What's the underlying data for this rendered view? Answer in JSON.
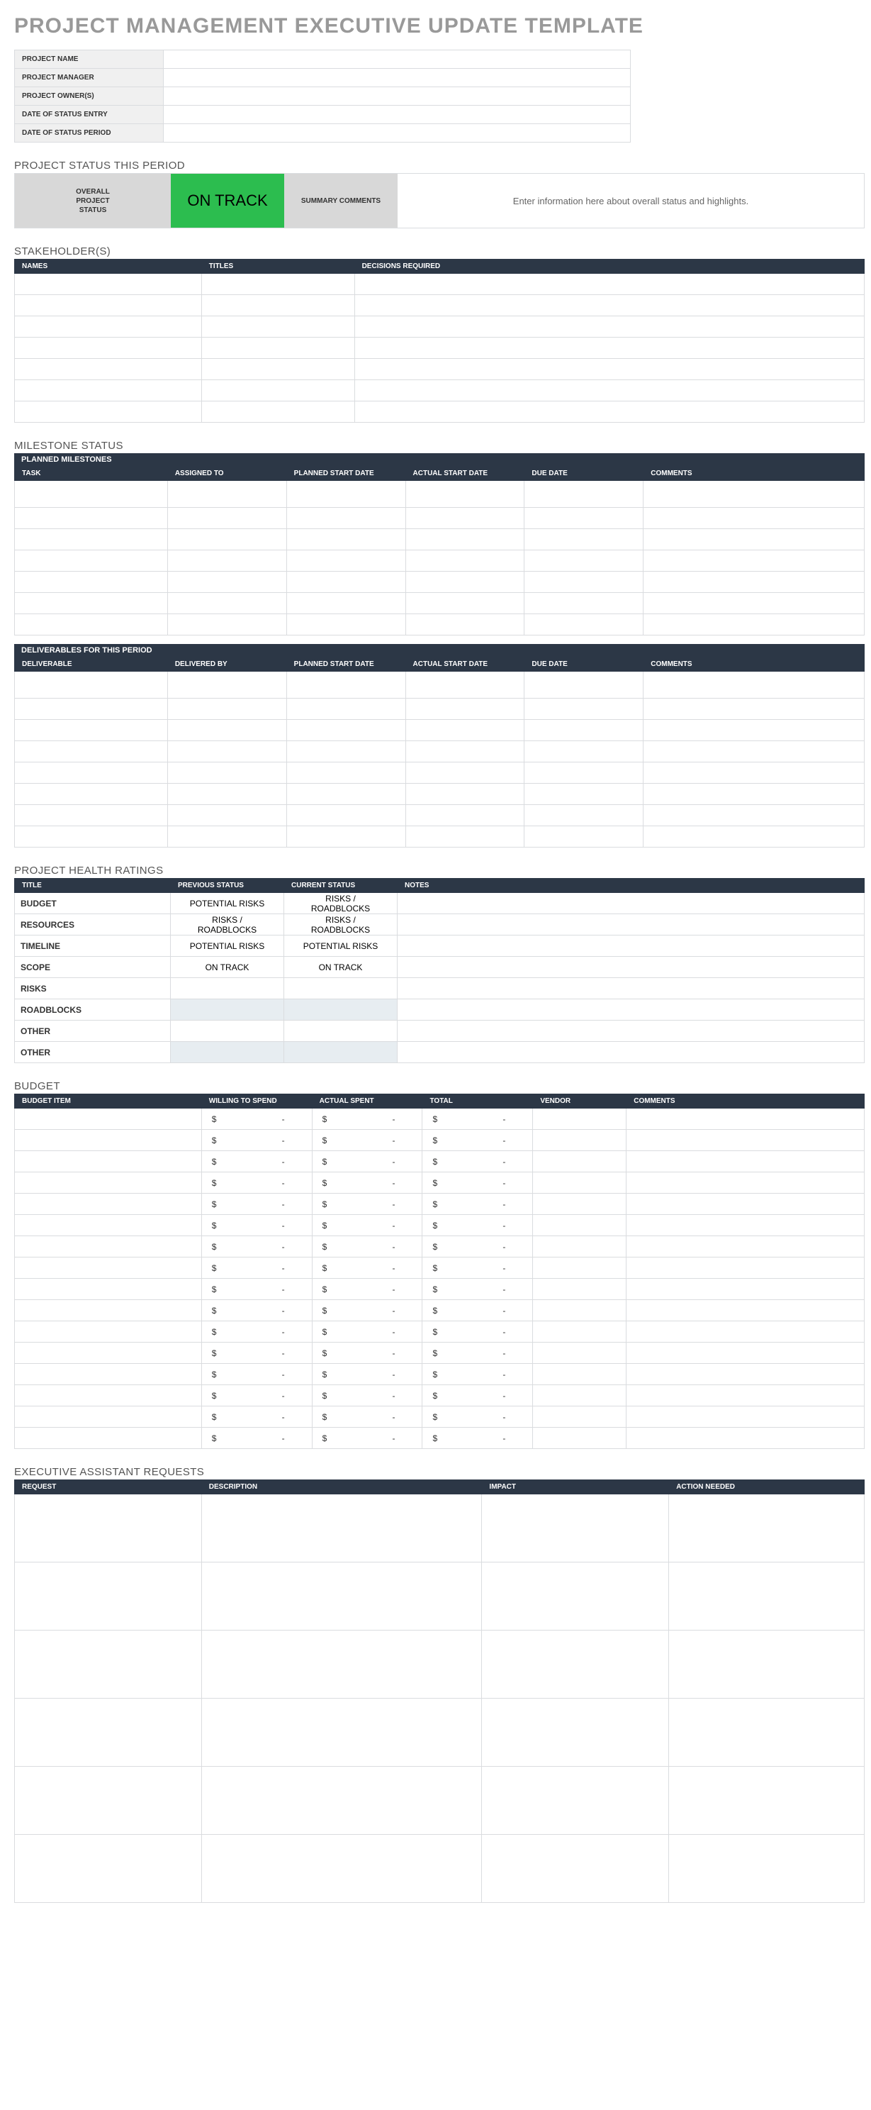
{
  "title": "PROJECT MANAGEMENT EXECUTIVE UPDATE TEMPLATE",
  "info_labels": [
    "PROJECT NAME",
    "PROJECT MANAGER",
    "PROJECT OWNER(S)",
    "DATE OF STATUS ENTRY",
    "DATE OF STATUS PERIOD"
  ],
  "status_period_heading": "PROJECT STATUS THIS PERIOD",
  "overall_label": "OVERALL\nPROJECT\nSTATUS",
  "overall_value": "ON TRACK",
  "summary_label": "SUMMARY COMMENTS",
  "summary_value": "Enter information here about overall status and highlights.",
  "sections": {
    "stakeholders": {
      "heading": "STAKEHOLDER(S)",
      "cols": [
        "NAMES",
        "TITLES",
        "DECISIONS REQUIRED"
      ],
      "rows": 7
    },
    "milestone": {
      "heading": "MILESTONE STATUS",
      "sub": "PLANNED MILESTONES",
      "cols": [
        "TASK",
        "ASSIGNED TO",
        "PLANNED START DATE",
        "ACTUAL START DATE",
        "DUE DATE",
        "COMMENTS"
      ],
      "rows": 6
    },
    "deliverables": {
      "sub": "DELIVERABLES FOR THIS PERIOD",
      "cols": [
        "DELIVERABLE",
        "DELIVERED BY",
        "PLANNED START DATE",
        "ACTUAL START DATE",
        "DUE DATE",
        "COMMENTS"
      ],
      "rows": 7
    },
    "health": {
      "heading": "PROJECT HEALTH RATINGS",
      "cols": [
        "TITLE",
        "PREVIOUS STATUS",
        "CURRENT STATUS",
        "NOTES"
      ],
      "rows": [
        {
          "t": "BUDGET",
          "prev": "POTENTIAL RISKS",
          "prev_c": "yellow",
          "cur": "RISKS / ROADBLOCKS",
          "cur_c": "red"
        },
        {
          "t": "RESOURCES",
          "prev": "RISKS / ROADBLOCKS",
          "prev_c": "red",
          "cur": "RISKS / ROADBLOCKS",
          "cur_c": "red"
        },
        {
          "t": "TIMELINE",
          "prev": "POTENTIAL RISKS",
          "prev_c": "yellow",
          "cur": "POTENTIAL RISKS",
          "cur_c": "yellow"
        },
        {
          "t": "SCOPE",
          "prev": "ON TRACK",
          "prev_c": "green",
          "cur": "ON TRACK",
          "cur_c": "green"
        },
        {
          "t": "RISKS",
          "prev": "",
          "prev_c": "white",
          "cur": "",
          "cur_c": "white"
        },
        {
          "t": "ROADBLOCKS",
          "prev": "",
          "prev_c": "",
          "cur": "",
          "cur_c": ""
        },
        {
          "t": "OTHER",
          "prev": "",
          "prev_c": "white",
          "cur": "",
          "cur_c": "white"
        },
        {
          "t": "OTHER",
          "prev": "",
          "prev_c": "",
          "cur": "",
          "cur_c": ""
        }
      ]
    },
    "budget": {
      "heading": "BUDGET",
      "cols": [
        "BUDGET ITEM",
        "WILLING TO SPEND",
        "ACTUAL SPENT",
        "TOTAL",
        "VENDOR",
        "COMMENTS"
      ],
      "rows": 16,
      "sym": "$",
      "dash": "-"
    },
    "exec": {
      "heading": "EXECUTIVE ASSISTANT REQUESTS",
      "cols": [
        "REQUEST",
        "DESCRIPTION",
        "IMPACT",
        "ACTION NEEDED"
      ],
      "rows": 6
    }
  }
}
